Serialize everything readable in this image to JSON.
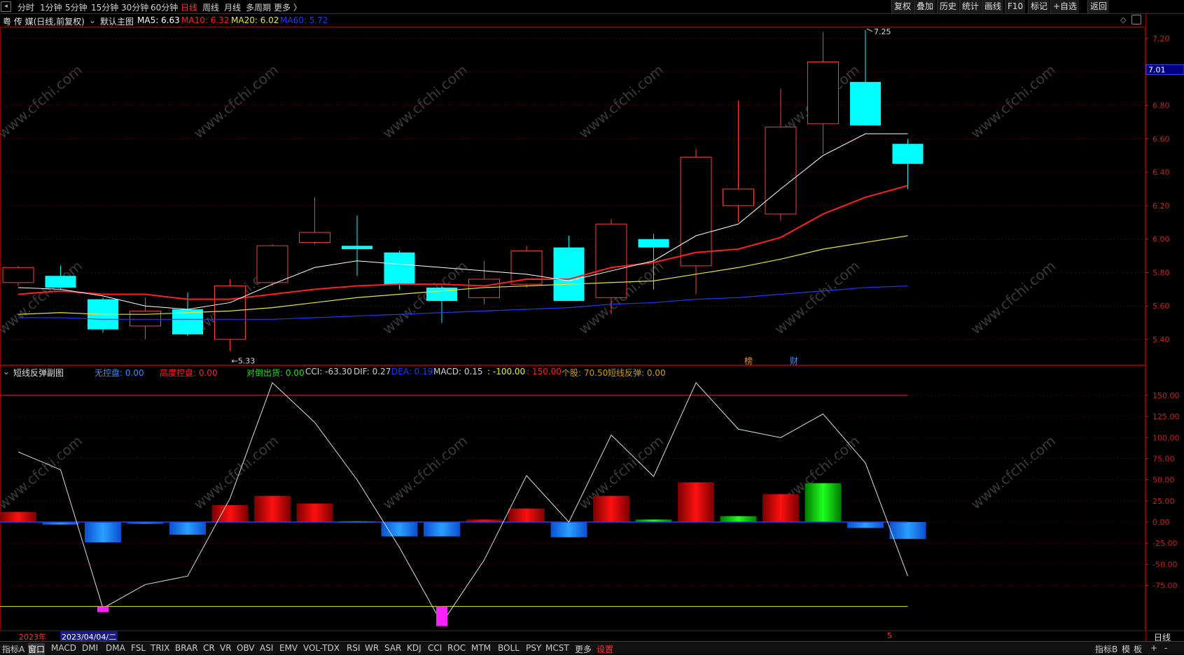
{
  "top_menu": {
    "back_icon": "back-arrow-icon",
    "periods": [
      "分时",
      "1分钟",
      "5分钟",
      "15分钟",
      "30分钟",
      "60分钟",
      "日线",
      "周线",
      "月线",
      "多周期",
      "更多 〉"
    ],
    "active_period": "日线",
    "right_buttons": [
      "复权",
      "叠加",
      "历史",
      "统计",
      "画线",
      "F10",
      "标记",
      "+自选",
      "返回"
    ]
  },
  "main_chart": {
    "stock_title": "粤 传 媒(日线,前复权)",
    "layout_label": "默认主图",
    "ma_labels": [
      {
        "text": "MA5: 6.63",
        "color": "#ffffff"
      },
      {
        "text": "MA10: 6.32",
        "color": "#ff2020"
      },
      {
        "text": "MA20: 6.02",
        "color": "#e8e830"
      },
      {
        "text": "MA60: 5.72",
        "color": "#1a3cff"
      }
    ],
    "y_ticks": [
      "7.20",
      "7.00",
      "6.80",
      "6.60",
      "6.40",
      "6.20",
      "6.00",
      "5.80",
      "5.60",
      "5.40"
    ],
    "current_price": "7.01",
    "high_marker": "7.25",
    "low_marker": "5.33",
    "event_marks": [
      "榜",
      "财"
    ]
  },
  "sub_chart": {
    "title": "短线反弹副图",
    "labels": [
      {
        "text": "无控盘: 0.00",
        "color": "#3a8bff"
      },
      {
        "text": "高度控盘: 0.00",
        "color": "#ff2020"
      },
      {
        "text": "对倒出货: 0.00",
        "color": "#20e020"
      },
      {
        "text": "CCI: -63.30",
        "color": "#d0d0d0"
      },
      {
        "text": "DIF: 0.27",
        "color": "#d0d0d0"
      },
      {
        "text": "DEA: 0.19",
        "color": "#1a3cff"
      },
      {
        "text": "MACD: 0.15",
        "color": "#d0d0d0"
      },
      {
        "text": ": -100.00",
        "color": "#e8e830"
      },
      {
        "text": ": 150.00",
        "color": "#ff2020"
      },
      {
        "text": "个股: 70.50",
        "color": "#c8a000"
      },
      {
        "text": "短线反弹: 0.00",
        "color": "#c8a000"
      }
    ],
    "y_ticks": [
      "150.00",
      "125.00",
      "100.00",
      "75.00",
      "50.00",
      "25.00",
      "0.00",
      "-25.00",
      "-50.00",
      "-75.00"
    ]
  },
  "date_bar": {
    "year": "2023年",
    "cursor_date": "2023/04/04/二",
    "month_mark": "5",
    "period_label": "日线"
  },
  "bottom_tabs": [
    "指标A",
    "窗口",
    "MACD",
    "DMI",
    "DMA",
    "FSL",
    "TRIX",
    "BRAR",
    "CR",
    "VR",
    "OBV",
    "ASI",
    "EMV",
    "VOL-TDX",
    "RSI",
    "WR",
    "SAR",
    "KDJ",
    "CCI",
    "ROC",
    "MTM",
    "BOLL",
    "PSY",
    "MCST",
    "更多",
    "设置"
  ],
  "bottom_right": [
    "指标B",
    "模",
    "板",
    "+",
    "-"
  ],
  "watermark": "www.cfchi.com",
  "chart_data": [
    {
      "type": "candlestick",
      "title": "粤 传 媒(日线,前复权)",
      "ylim": [
        5.3,
        7.3
      ],
      "candles": [
        {
          "open": 5.74,
          "high": 5.84,
          "low": 5.72,
          "close": 5.83
        },
        {
          "open": 5.78,
          "high": 5.84,
          "low": 5.7,
          "close": 5.71
        },
        {
          "open": 5.64,
          "high": 5.65,
          "low": 5.44,
          "close": 5.46
        },
        {
          "open": 5.48,
          "high": 5.65,
          "low": 5.4,
          "close": 5.57
        },
        {
          "open": 5.58,
          "high": 5.68,
          "low": 5.42,
          "close": 5.43
        },
        {
          "open": 5.4,
          "high": 5.76,
          "low": 5.33,
          "close": 5.72
        },
        {
          "open": 5.74,
          "high": 5.97,
          "low": 5.72,
          "close": 5.96
        },
        {
          "open": 5.98,
          "high": 6.25,
          "low": 5.97,
          "close": 6.04
        },
        {
          "open": 5.96,
          "high": 6.14,
          "low": 5.78,
          "close": 5.94
        },
        {
          "open": 5.92,
          "high": 5.93,
          "low": 5.7,
          "close": 5.73
        },
        {
          "open": 5.71,
          "high": 5.72,
          "low": 5.5,
          "close": 5.63
        },
        {
          "open": 5.65,
          "high": 5.87,
          "low": 5.61,
          "close": 5.76
        },
        {
          "open": 5.73,
          "high": 5.96,
          "low": 5.71,
          "close": 5.93
        },
        {
          "open": 5.95,
          "high": 6.02,
          "low": 5.63,
          "close": 5.63
        },
        {
          "open": 5.65,
          "high": 6.12,
          "low": 5.55,
          "close": 6.09
        },
        {
          "open": 6.0,
          "high": 6.03,
          "low": 5.7,
          "close": 5.95
        },
        {
          "open": 5.84,
          "high": 6.54,
          "low": 5.67,
          "close": 6.49
        },
        {
          "open": 6.2,
          "high": 6.83,
          "low": 6.1,
          "close": 6.3
        },
        {
          "open": 6.15,
          "high": 6.9,
          "low": 6.11,
          "close": 6.67
        },
        {
          "open": 6.69,
          "high": 7.24,
          "low": 6.51,
          "close": 7.06
        },
        {
          "open": 6.94,
          "high": 7.25,
          "low": 6.68,
          "close": 6.68
        },
        {
          "open": 6.57,
          "high": 6.6,
          "low": 6.3,
          "close": 6.45
        }
      ],
      "ma5": [
        5.71,
        5.7,
        5.66,
        5.6,
        5.58,
        5.62,
        5.73,
        5.83,
        5.87,
        5.85,
        5.83,
        5.81,
        5.79,
        5.75,
        5.81,
        5.87,
        6.02,
        6.09,
        6.3,
        6.5,
        6.63,
        6.63
      ],
      "ma10": [
        5.67,
        5.69,
        5.67,
        5.67,
        5.64,
        5.64,
        5.67,
        5.7,
        5.72,
        5.73,
        5.73,
        5.72,
        5.76,
        5.76,
        5.83,
        5.86,
        5.92,
        5.94,
        6.01,
        6.15,
        6.25,
        6.32
      ],
      "ma20": [
        5.55,
        5.56,
        5.55,
        5.55,
        5.56,
        5.57,
        5.59,
        5.62,
        5.65,
        5.67,
        5.69,
        5.71,
        5.72,
        5.73,
        5.74,
        5.75,
        5.79,
        5.83,
        5.88,
        5.94,
        5.98,
        6.02
      ],
      "ma60": [
        5.53,
        5.53,
        5.52,
        5.52,
        5.52,
        5.52,
        5.52,
        5.53,
        5.54,
        5.55,
        5.56,
        5.57,
        5.58,
        5.59,
        5.61,
        5.62,
        5.64,
        5.65,
        5.67,
        5.69,
        5.71,
        5.72
      ]
    },
    {
      "type": "bar+line",
      "title": "短线反弹副图",
      "ylim": [
        -125,
        170
      ],
      "bars": [
        {
          "value": 12,
          "color": "red"
        },
        {
          "value": -3,
          "color": "blue"
        },
        {
          "value": -24,
          "color": "blue"
        },
        {
          "value": -2,
          "color": "blue"
        },
        {
          "value": -15,
          "color": "blue"
        },
        {
          "value": 20,
          "color": "red"
        },
        {
          "value": 31,
          "color": "red"
        },
        {
          "value": 22,
          "color": "red"
        },
        {
          "value": 1,
          "color": "green"
        },
        {
          "value": -17,
          "color": "blue"
        },
        {
          "value": -17,
          "color": "blue"
        },
        {
          "value": 3,
          "color": "red"
        },
        {
          "value": 16,
          "color": "red"
        },
        {
          "value": -18,
          "color": "blue"
        },
        {
          "value": 31,
          "color": "red"
        },
        {
          "value": 3,
          "color": "green"
        },
        {
          "value": 47,
          "color": "red"
        },
        {
          "value": 7,
          "color": "green"
        },
        {
          "value": 33,
          "color": "red"
        },
        {
          "value": 46,
          "color": "green"
        },
        {
          "value": -7,
          "color": "blue"
        },
        {
          "value": -20,
          "color": "blue"
        }
      ],
      "line": [
        83,
        62,
        -102,
        -74,
        -64,
        28,
        165,
        118,
        50,
        -30,
        -120,
        -45,
        55,
        0,
        103,
        54,
        165,
        110,
        100,
        128,
        70,
        -64
      ],
      "markers": [
        {
          "index": 2,
          "value": -100
        },
        {
          "index": 10,
          "value": -100
        }
      ],
      "ref_lines": [
        150,
        0,
        -100
      ]
    }
  ]
}
